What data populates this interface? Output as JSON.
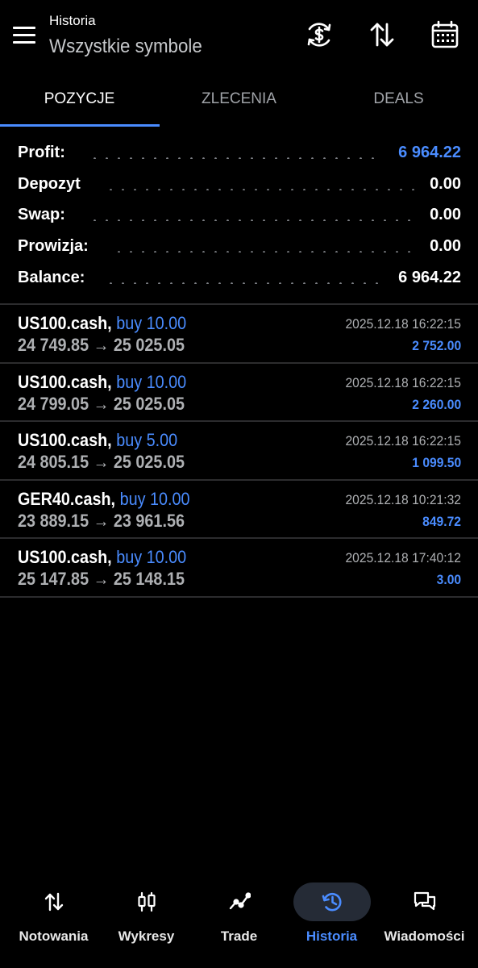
{
  "header": {
    "subtitle": "Historia",
    "title": "Wszystkie symbole",
    "icons": [
      "currency-exchange-icon",
      "sort-arrows-icon",
      "calendar-icon"
    ]
  },
  "tabs": [
    {
      "label": "POZYCJE",
      "active": true
    },
    {
      "label": "ZLECENIA",
      "active": false
    },
    {
      "label": "DEALS",
      "active": false
    }
  ],
  "summary": [
    {
      "label": "Profit:",
      "value": "6 964.22",
      "highlight": true
    },
    {
      "label": "Depozyt",
      "value": "0.00",
      "highlight": false
    },
    {
      "label": "Swap:",
      "value": "0.00",
      "highlight": false
    },
    {
      "label": "Prowizja:",
      "value": "0.00",
      "highlight": false
    },
    {
      "label": "Balance:",
      "value": "6 964.22",
      "highlight": false
    }
  ],
  "deals": [
    {
      "symbol": "US100.cash,",
      "action": "buy 10.00",
      "prices": "24 749.85 → 25 025.05",
      "time": "2025.12.18 16:22:15",
      "profit": "2 752.00"
    },
    {
      "symbol": "US100.cash,",
      "action": "buy 10.00",
      "prices": "24 799.05 → 25 025.05",
      "time": "2025.12.18 16:22:15",
      "profit": "2 260.00"
    },
    {
      "symbol": "US100.cash,",
      "action": "buy 5.00",
      "prices": "24 805.15 → 25 025.05",
      "time": "2025.12.18 16:22:15",
      "profit": "1 099.50"
    },
    {
      "symbol": "GER40.cash,",
      "action": "buy 10.00",
      "prices": "23 889.15 → 23 961.56",
      "time": "2025.12.18 10:21:32",
      "profit": "849.72"
    },
    {
      "symbol": "US100.cash,",
      "action": "buy 10.00",
      "prices": "25 147.85 → 25 148.15",
      "time": "2025.12.18 17:40:12",
      "profit": "3.00"
    }
  ],
  "bottom_nav": [
    {
      "label": "Notowania",
      "icon": "quotes-arrows-icon",
      "active": false
    },
    {
      "label": "Wykresy",
      "icon": "candlestick-icon",
      "active": false
    },
    {
      "label": "Trade",
      "icon": "trade-line-icon",
      "active": false
    },
    {
      "label": "Historia",
      "icon": "history-icon",
      "active": true
    },
    {
      "label": "Wiadomości",
      "icon": "messages-icon",
      "active": false
    }
  ],
  "colors": {
    "background": "#000000",
    "accent": "#4a8cff",
    "muted_text": "#aeb0b3",
    "separator": "#2c2c2e",
    "active_nav_bg": "#252b36"
  }
}
